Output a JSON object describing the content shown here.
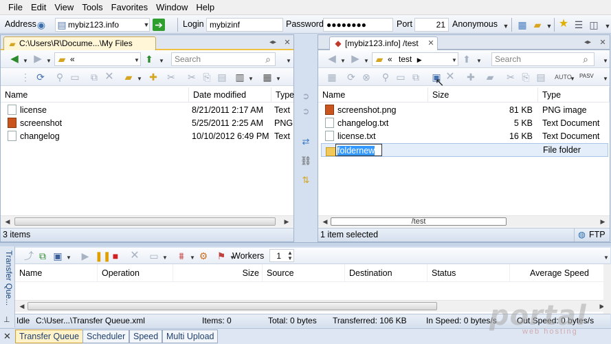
{
  "menu": [
    "File",
    "Edit",
    "View",
    "Tools",
    "Favorites",
    "Window",
    "Help"
  ],
  "address": {
    "label": "Address",
    "value": "mybiz123.info",
    "login_label": "Login",
    "login_value": "mybizinf",
    "password_label": "Password",
    "password_value": "●●●●●●●●",
    "port_label": "Port",
    "port_value": "21",
    "mode": "Anonymous"
  },
  "local": {
    "tab": "C:\\Users\\R\\Docume...\\My Files",
    "path_part": "«",
    "search_placeholder": "Search",
    "columns": [
      "Name",
      "Date modified",
      "Type"
    ],
    "files": [
      {
        "name": "license",
        "date": "8/21/2011 2:17 AM",
        "type": "Text",
        "icon": "text-file-icon"
      },
      {
        "name": "screenshot",
        "date": "5/25/2011 2:25 AM",
        "type": "PNG",
        "icon": "png-file-icon"
      },
      {
        "name": "changelog",
        "date": "10/10/2012 6:49 PM",
        "type": "Text",
        "icon": "text-file-icon"
      }
    ],
    "status": "3 items"
  },
  "remote": {
    "tab": "[mybiz123.info] /test",
    "path_part": "«",
    "path_folder": "test",
    "search_placeholder": "Search",
    "columns": [
      "Name",
      "Size",
      "Type"
    ],
    "files": [
      {
        "name": "screenshot.png",
        "size": "81 KB",
        "type": "PNG image",
        "icon": "png-file-icon"
      },
      {
        "name": "changelog.txt",
        "size": "5 KB",
        "type": "Text Document",
        "icon": "text-file-icon"
      },
      {
        "name": "license.txt",
        "size": "16 KB",
        "type": "Text Document",
        "icon": "text-file-icon"
      }
    ],
    "new_folder": {
      "name": "foldernew",
      "type": "File folder"
    },
    "path_edit": "/test",
    "status": "1 item selected",
    "protocol": "FTP",
    "pasv": "PASV"
  },
  "queue": {
    "side_label": "Transfer Que...",
    "workers_label": "Workers",
    "workers_value": "1",
    "columns": [
      "Name",
      "Operation",
      "Size",
      "Source",
      "Destination",
      "Status",
      "Average Speed"
    ],
    "status": {
      "state": "Idle",
      "file": "C:\\User...\\Transfer Queue.xml",
      "items": "Items: 0",
      "total": "Total: 0 bytes",
      "transferred": "Transferred: 106 KB",
      "in_speed": "In Speed: 0 bytes/s",
      "out_speed": "Out Speed: 0 bytes/s"
    }
  },
  "bottom_tabs": [
    "Transfer Queue",
    "Scheduler",
    "Speed",
    "Multi Upload"
  ],
  "watermark": {
    "main": "portal",
    "sub": "web hosting"
  }
}
